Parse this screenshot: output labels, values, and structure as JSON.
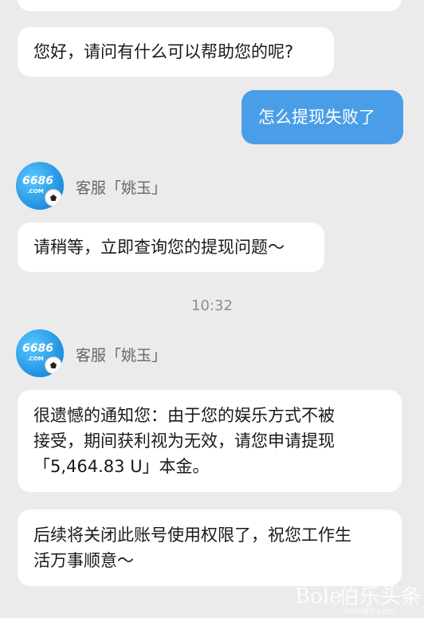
{
  "messages": {
    "greeting": "您好，请问有什么可以帮助您的呢?",
    "user_question": "怎么提现失败了",
    "reply_wait": "请稍等，立即查询您的提现问题～",
    "timestamp": "10:32",
    "notice_line1": "很遗憾的通知您：由于您的娱乐方式不被",
    "notice_line2": "接受，期间获利视为无效，请您申请提现",
    "notice_line3": "「5,464.83 U」本金。",
    "closing_line1": "后续将关闭此账号使用权限了，祝您工作生",
    "closing_line2": "活万事顺意～"
  },
  "agent": {
    "name": "客服「姚玉」",
    "avatar_brand": "6686",
    "avatar_domain": ".COM"
  },
  "watermark": {
    "left": "Bole",
    "right": "伯乐头条",
    "sub": "bole90.com"
  },
  "colors": {
    "background": "#ebebeb",
    "user_bubble": "#4a9ee8",
    "agent_bubble": "#ffffff"
  }
}
